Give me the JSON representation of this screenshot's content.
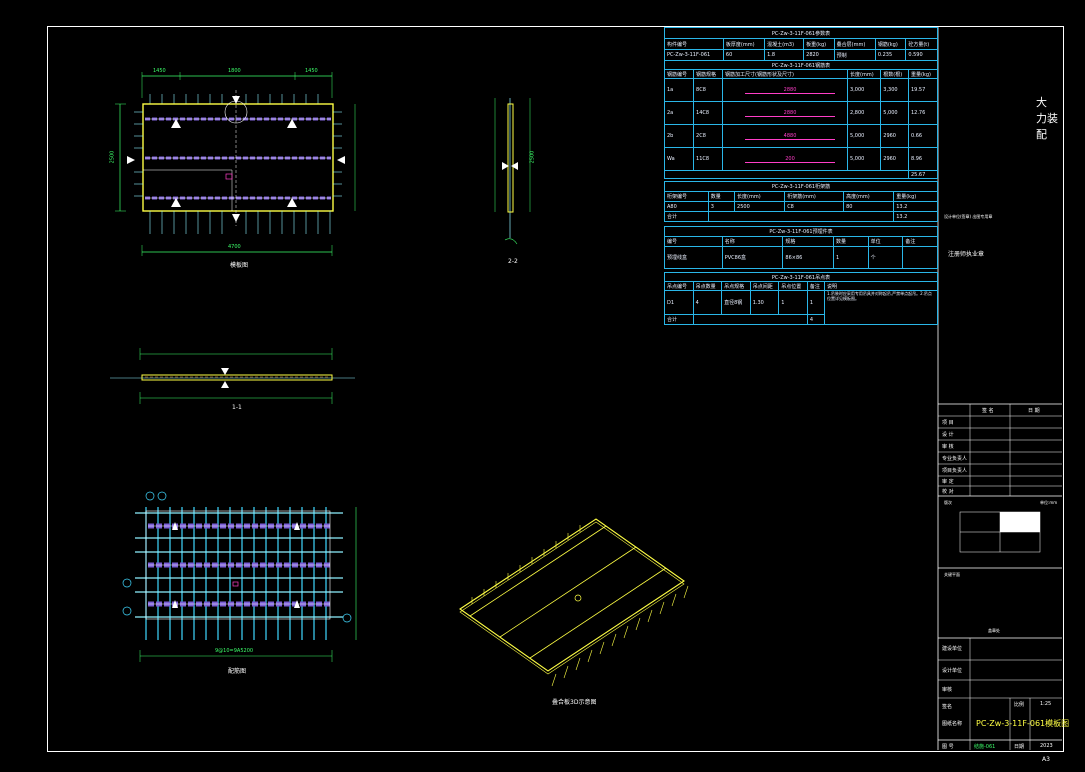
{
  "colors": {
    "background": "#000000",
    "frame": "#ffffff",
    "table_border": "#2ab6e8",
    "rebar": "#7b5fd6",
    "yellow": "#ffff44",
    "cyan": "#40d8ff",
    "green": "#3cff6a",
    "magenta": "#ff3ec8"
  },
  "drawing": {
    "views": {
      "plan_label": "模板图",
      "section_1_1": "1-1",
      "section_2_2": "2-2",
      "rebar_plan_label": "配筋图",
      "iso_label": "叠合板3D示意图",
      "sheet_no": "A3"
    },
    "dims": {
      "plan_top": [
        "1450",
        "1800",
        "1450"
      ],
      "plan_bottom": "4700",
      "plan_left": "2500",
      "rebar_bottom": "9@10=9A5200",
      "side_center": "2500"
    }
  },
  "tables": {
    "component": {
      "title": "PC-Zw-3-11F-061参数表",
      "headers": [
        "构件编号",
        "板厚度(mm)",
        "混凝土(m3)",
        "板重(kg)",
        "叠合层(mm)",
        "钢筋(kg)",
        "砼方量(t)"
      ],
      "row": [
        "PC-Zw-3-11F-061",
        "60",
        "1.8",
        "2820",
        "预制",
        "0.235",
        "0.590"
      ]
    },
    "rebar": {
      "title": "PC-Zw-3-11F-061钢筋表",
      "headers": [
        "钢筋编号",
        "钢筋规格",
        "钢筋加工尺寸(钢筋形状及尺寸)",
        "长度(mm)",
        "根数(根)",
        "重量(kg)"
      ],
      "rows": [
        [
          "1a",
          "8C8",
          "2880",
          "3,000",
          "3,300",
          "19.57"
        ],
        [
          "2a",
          "14C8",
          "2880",
          "2,800",
          "5,000",
          "12.76"
        ],
        [
          "2b",
          "2C8",
          "4880",
          "5,000",
          "2960",
          "0.66"
        ],
        [
          "Wa",
          "11C8",
          "200",
          "5,000",
          "2960",
          "8.96"
        ]
      ],
      "total": "25.67"
    },
    "truss": {
      "title": "PC-Zw-3-11F-061桁架筋",
      "headers": [
        "桁架编号",
        "数量",
        "长度(mm)",
        "桁架筋(mm)",
        "高度(mm)",
        "重量(kg)"
      ],
      "rows": [
        [
          "A80",
          "3",
          "2500",
          "C8",
          "80",
          "13.2"
        ],
        [
          "合计",
          "",
          "",
          "",
          "",
          "13.2"
        ]
      ]
    },
    "embed": {
      "title": "PC-Zw-3-11F-061预埋件表",
      "headers": [
        "编号",
        "名称",
        "规格",
        "数量",
        "单位",
        "备注"
      ],
      "row": [
        "预埋线盒",
        "PVC86盒",
        "86×86",
        "1",
        "个",
        ""
      ]
    },
    "lifting": {
      "title": "PC-Zw-3-11F-061吊点表",
      "headers": [
        "吊点编号",
        "吊点数量",
        "吊点规格",
        "吊点间距",
        "吊点位置",
        "备注",
        "说明"
      ],
      "rows": [
        [
          "D1",
          "4",
          "直径8钢",
          "1.30",
          "1",
          "1",
          "吊装时应采用专用吊具,吊点应均匀受力"
        ],
        [
          "合计",
          "",
          "",
          "",
          "",
          "4",
          ""
        ]
      ],
      "note": "1.吊装时应采用专用吊具并对称起吊,严禁单点起吊。2.吊点位置详见模板图。"
    }
  },
  "title_block": {
    "project": "大",
    "project_line2": "力装",
    "project_line3": "配",
    "company_note": "设计单位(签章) 出图专用章",
    "stamp": "注册师执业章",
    "left_labels": [
      "项 目",
      "设 计",
      "审 核",
      "专业负责人",
      "项目负责人",
      "审 定",
      "校 对",
      "设计单位"
    ],
    "col_headers": [
      "签 名",
      "日 期"
    ],
    "scale_label": "比例",
    "scale": "1:25",
    "drawing_name_label": "图纸名称",
    "drawing_name": "PC-Zw-3-11F-061模板图",
    "sheet_label": "图 号",
    "sheet_val": "结施-061",
    "date_label": "日期",
    "date_val": "2023",
    "sign_label": "签名",
    "construction_label": "建设单位",
    "design_label": "设计单位",
    "revision": "版次",
    "approval": "审核",
    "units_note": "单位:mm",
    "key_plan": "关键平面",
    "seal_note": "盖章处"
  }
}
